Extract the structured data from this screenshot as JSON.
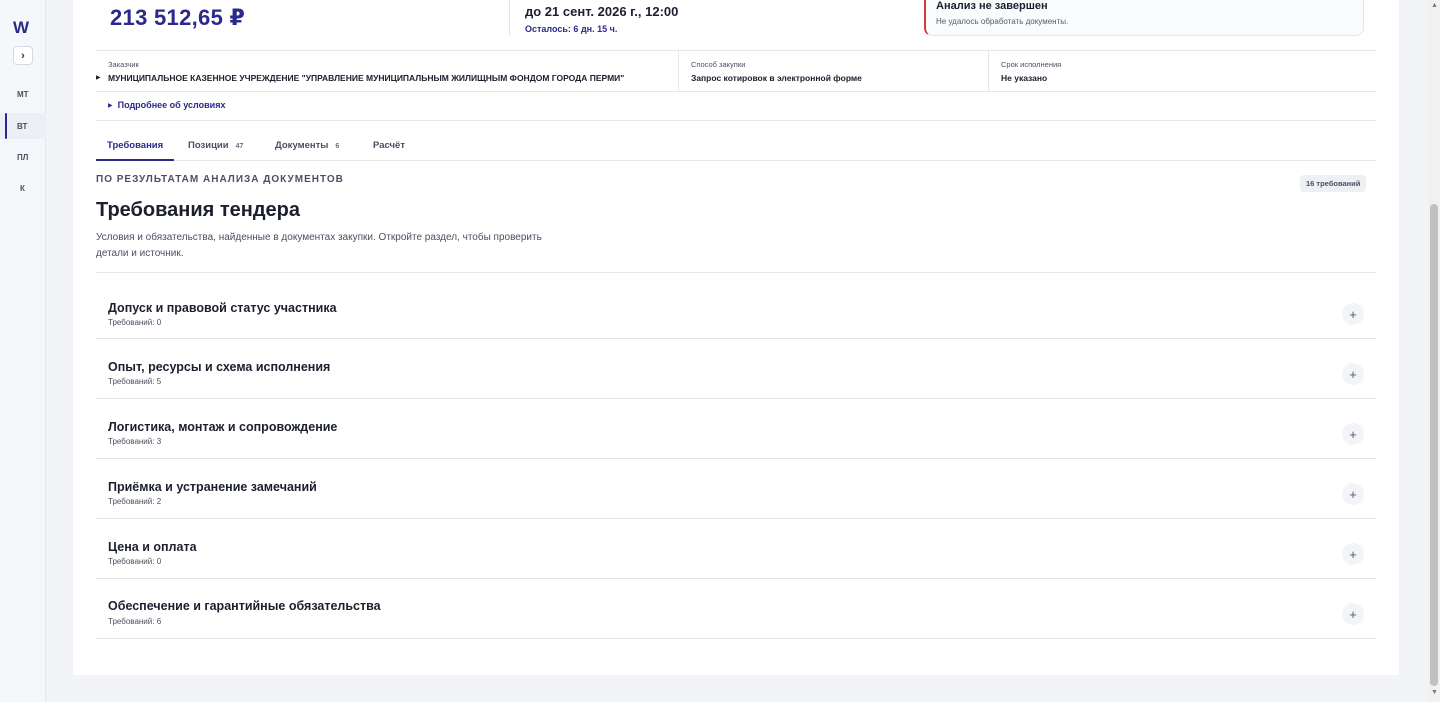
{
  "sidebar": {
    "logo": "W",
    "expand_label": "›",
    "items": [
      {
        "label": "МТ",
        "active": false
      },
      {
        "label": "ВТ",
        "active": true
      },
      {
        "label": "ПЛ",
        "active": false
      },
      {
        "label": "К",
        "active": false
      }
    ]
  },
  "summary": {
    "price": "213 512,65 ₽",
    "deadline": "до 21 сент. 2026 г., 12:00",
    "remaining": "Осталось: 6 дн. 15 ч.",
    "alert_title": "Анализ не завершен",
    "alert_text": "Не удалось обработать документы.",
    "alert_color": "#d33a3a"
  },
  "info": {
    "customer_label": "Заказчик",
    "customer_value": "МУНИЦИПАЛЬНОЕ КАЗЕННОЕ УЧРЕЖДЕНИЕ \"УПРАВЛЕНИЕ МУНИЦИПАЛЬНЫМ ЖИЛИЩНЫМ ФОНДОМ ГОРОДА ПЕРМИ\"",
    "method_label": "Способ закупки",
    "method_value": "Запрос котировок в электронной форме",
    "term_label": "Срок исполнения",
    "term_value": "Не указано",
    "more_label": "Подробнее об условиях"
  },
  "tabs": [
    {
      "label": "Требования",
      "count": "",
      "active": true
    },
    {
      "label": "Позиции",
      "count": "47",
      "active": false
    },
    {
      "label": "Документы",
      "count": "6",
      "active": false
    },
    {
      "label": "Расчёт",
      "count": "",
      "active": false
    }
  ],
  "requirements": {
    "kicker": "ПО РЕЗУЛЬТАТАМ АНАЛИЗА ДОКУМЕНТОВ",
    "badge": "16 требований",
    "title": "Требования тендера",
    "description": "Условия и обязательства, найденные в документах закупки. Откройте раздел, чтобы проверить детали и источник.",
    "sections": [
      {
        "title": "Допуск и правовой статус участника",
        "subtitle": "Требований: 0",
        "toggle": "+"
      },
      {
        "title": "Опыт, ресурсы и схема исполнения",
        "subtitle": "Требований: 5",
        "toggle": "+"
      },
      {
        "title": "Логистика, монтаж и сопровождение",
        "subtitle": "Требований: 3",
        "toggle": "+"
      },
      {
        "title": "Приёмка и устранение замечаний",
        "subtitle": "Требований: 2",
        "toggle": "+"
      },
      {
        "title": "Цена и оплата",
        "subtitle": "Требований: 0",
        "toggle": "+"
      },
      {
        "title": "Обеспечение и гарантийные обязательства",
        "subtitle": "Требований: 6",
        "toggle": "+"
      }
    ]
  },
  "colors": {
    "accent": "#2b2a8a",
    "background": "#f3f4f7"
  }
}
